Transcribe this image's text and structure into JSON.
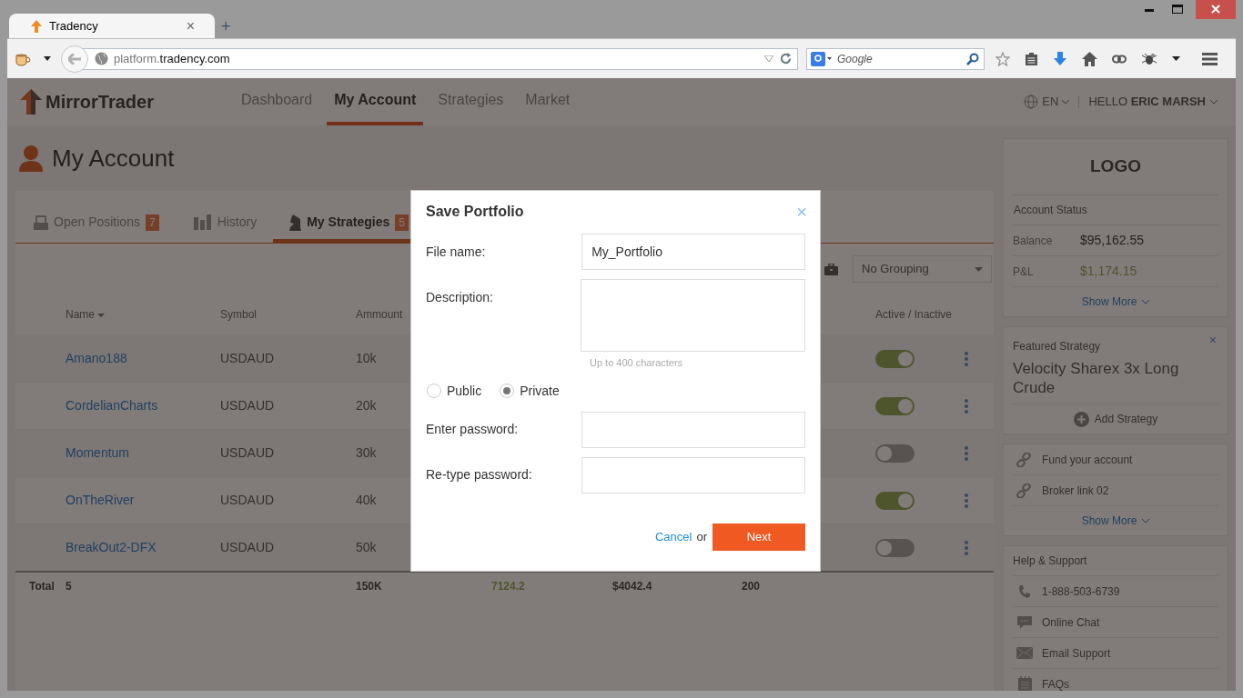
{
  "browser": {
    "tab_title": "Tradency",
    "tab_close": "×",
    "new_tab": "+",
    "url_subdomain": "platform.",
    "url_domain": "tradency.com",
    "search_placeholder": "Google"
  },
  "header": {
    "brand": "MirrorTrader",
    "nav": [
      {
        "label": "Dashboard",
        "selected": false
      },
      {
        "label": "My Account",
        "selected": true
      },
      {
        "label": "Strategies",
        "selected": false
      },
      {
        "label": "Market",
        "selected": false
      }
    ],
    "language": "EN",
    "greeting": "HELLO **ERIC MARSH**"
  },
  "page_title": "My Account",
  "tabs": [
    {
      "label": "Open Positions",
      "count": "7",
      "selected": false
    },
    {
      "label": "History",
      "selected": false
    },
    {
      "label": "My Strategies",
      "count": "5",
      "selected": true
    }
  ],
  "grouping": "No Grouping",
  "table": {
    "columns": [
      "Name",
      "Symbol",
      "Ammount",
      "Active / Inactive"
    ],
    "rows": [
      {
        "name": "Amano188",
        "symbol": "USDAUD",
        "amount": "10k",
        "active": true
      },
      {
        "name": "CordelianCharts",
        "symbol": "USDAUD",
        "amount": "20k",
        "active": true
      },
      {
        "name": "Momentum",
        "symbol": "USDAUD",
        "amount": "30k",
        "active": false
      },
      {
        "name": "OnTheRiver",
        "symbol": "USDAUD",
        "amount": "40k",
        "active": true
      },
      {
        "name": "BreakOut2-DFX",
        "symbol": "USDAUD",
        "amount": "50k",
        "active": false
      }
    ],
    "total": {
      "label": "Total",
      "count": "5",
      "amount": "150K",
      "column_4": "7124.2",
      "column_5": "$4042.4",
      "column_6": "200"
    }
  },
  "sidebar": {
    "logo": "LOGO",
    "account_status": "Account Status",
    "balance_label": "Balance",
    "balance": "$95,162.55",
    "pnl_label": "P&L",
    "pnl": "$1,174.15",
    "show_more": "Show More",
    "featured_label": "Featured Strategy",
    "featured_close": "×",
    "featured_name": "Velocity Sharex 3x Long Crude",
    "add_strategy": "Add Strategy",
    "links": [
      "Fund your account",
      "Broker link 02"
    ],
    "links_show_more": "Show More",
    "help_title": "Help & Support",
    "help_items": [
      {
        "kind": "phone",
        "label": "1-888-503-6739"
      },
      {
        "kind": "chat",
        "label": "Online Chat"
      },
      {
        "kind": "email",
        "label": "Email Support"
      },
      {
        "kind": "faq",
        "label": "FAQs"
      }
    ]
  },
  "dialog": {
    "title": "Save Portfolio",
    "close": "×",
    "file_name_label": "File name:",
    "file_name": "My_Portfolio",
    "description_label": "Description:",
    "description_hint": "Up to 400 characters",
    "visibility": [
      {
        "label": "Public",
        "selected": false
      },
      {
        "label": "Private",
        "selected": true
      }
    ],
    "password_label": "Enter password:",
    "retype_label": "Re-type password:",
    "cancel": "Cancel",
    "or": "or",
    "next": "Next"
  }
}
